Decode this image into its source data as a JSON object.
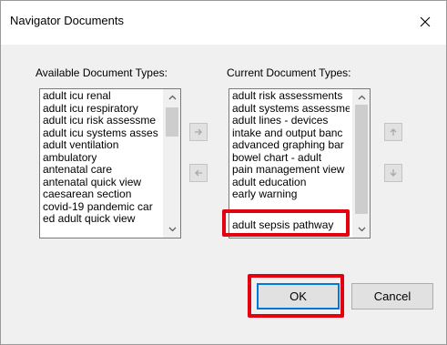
{
  "window": {
    "title": "Navigator Documents",
    "close_icon": "close-icon"
  },
  "available": {
    "label": "Available Document Types:",
    "items": [
      "adult icu renal",
      "adult icu respiratory",
      "adult icu risk assessme",
      "adult icu systems asses",
      "adult ventilation",
      "ambulatory",
      "antenatal care",
      "antenatal quick view",
      "caesarean section",
      "covid-19 pandemic car",
      "ed adult quick view"
    ]
  },
  "current": {
    "label": "Current Document Types:",
    "items": [
      "adult risk assessments",
      "adult systems assessme",
      "adult lines - devices",
      "intake and output banc",
      "advanced graphing bar",
      "bowel chart - adult",
      "pain management view",
      "adult education",
      "early warning"
    ],
    "selected_item": "adult sepsis pathway"
  },
  "move_buttons": {
    "add_icon": "arrow-right-icon",
    "remove_icon": "arrow-left-icon",
    "up_icon": "arrow-up-icon",
    "down_icon": "arrow-down-icon"
  },
  "footer": {
    "ok_label": "OK",
    "cancel_label": "Cancel"
  },
  "colors": {
    "highlight": "#e3000f",
    "accent": "#0078d7"
  }
}
